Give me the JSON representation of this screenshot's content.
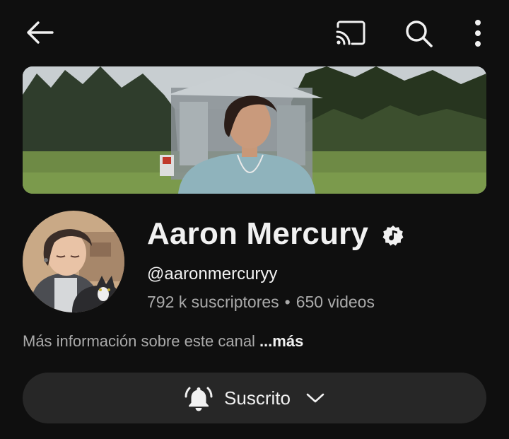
{
  "header": {
    "icons": [
      "back-arrow-icon",
      "cast-icon",
      "search-icon",
      "more-vertical-icon"
    ]
  },
  "channel": {
    "name": "Aaron Mercury",
    "verified_icon": "verified-music-note-icon",
    "handle": "@aaronmercuryy",
    "subscribers": "792 k suscriptores",
    "separator": "•",
    "videos": "650 videos",
    "about_text": "Más información sobre este canal",
    "about_more": "...más"
  },
  "subscribe_button": {
    "label": "Suscrito",
    "bell_icon": "notification-bell-icon",
    "chevron_icon": "chevron-down-icon"
  },
  "colors": {
    "background": "#0f0f0f",
    "text_primary": "#f1f1f1",
    "text_secondary": "#aaaaaa",
    "button_bg": "#272727"
  }
}
